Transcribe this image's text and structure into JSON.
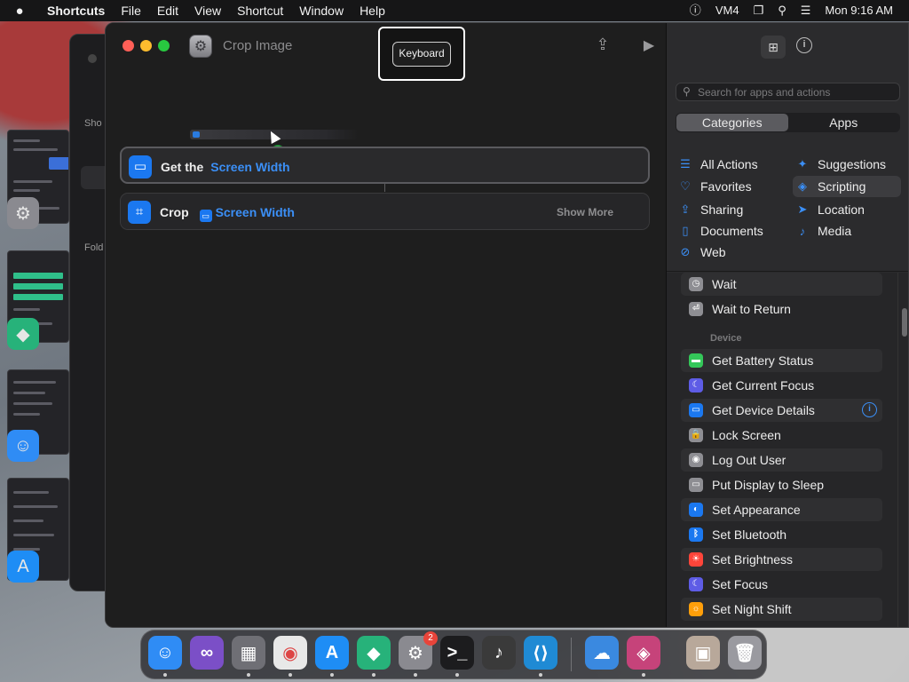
{
  "menubar": {
    "apple_icon": "apple-logo",
    "app_name": "Shortcuts",
    "menus": [
      "File",
      "Edit",
      "View",
      "Shortcut",
      "Window",
      "Help"
    ],
    "status": {
      "vm": "VM4",
      "clock": "Mon 9:16 AM"
    }
  },
  "window": {
    "title": "Crop Image",
    "tooltip": "Keyboard"
  },
  "editor": {
    "actions": [
      {
        "verb": "Get the",
        "token": "Screen Width"
      },
      {
        "verb": "Crop",
        "token": "Screen Width",
        "more": "Show More"
      }
    ]
  },
  "sidebar": {
    "search_placeholder": "Search for apps and actions",
    "segments": [
      "Categories",
      "Apps"
    ],
    "categories_left": [
      {
        "label": "All Actions",
        "icon": "list-icon"
      },
      {
        "label": "Favorites",
        "icon": "heart-icon"
      },
      {
        "label": "Sharing",
        "icon": "share-icon"
      },
      {
        "label": "Documents",
        "icon": "document-icon"
      },
      {
        "label": "Web",
        "icon": "compass-icon"
      }
    ],
    "categories_right": [
      {
        "label": "Suggestions",
        "icon": "sparkle-icon"
      },
      {
        "label": "Scripting",
        "icon": "scripting-icon"
      },
      {
        "label": "Location",
        "icon": "location-icon"
      },
      {
        "label": "Media",
        "icon": "music-note-icon"
      }
    ],
    "list": {
      "scripting_rows": [
        "Wait",
        "Wait to Return"
      ],
      "section": "Device",
      "device_rows": [
        {
          "label": "Get Battery Status",
          "color": "#34c759",
          "icon": "battery-icon"
        },
        {
          "label": "Get Current Focus",
          "color": "#5e5ce6",
          "icon": "moon-icon"
        },
        {
          "label": "Get Device Details",
          "color": "#1b78f0",
          "icon": "display-icon"
        },
        {
          "label": "Lock Screen",
          "color": "#8e8e93",
          "icon": "lock-icon"
        },
        {
          "label": "Log Out User",
          "color": "#8e8e93",
          "icon": "user-icon"
        },
        {
          "label": "Put Display to Sleep",
          "color": "#8e8e93",
          "icon": "display-sleep-icon"
        },
        {
          "label": "Set Appearance",
          "color": "#1b78f0",
          "icon": "appearance-icon"
        },
        {
          "label": "Set Bluetooth",
          "color": "#1b78f0",
          "icon": "bluetooth-icon"
        },
        {
          "label": "Set Brightness",
          "color": "#ff453a",
          "icon": "brightness-icon"
        },
        {
          "label": "Set Focus",
          "color": "#5e5ce6",
          "icon": "moon-icon"
        },
        {
          "label": "Set Night Shift",
          "color": "#ff9f0a",
          "icon": "night-shift-icon"
        }
      ]
    }
  },
  "dock": {
    "apps": [
      {
        "name": "finder-icon",
        "color": "#2f8cf5"
      },
      {
        "name": "visual-studio-icon",
        "color": "#7b4fc7"
      },
      {
        "name": "grid-tool-icon",
        "color": "#6f6f75"
      },
      {
        "name": "chrome-icon",
        "color": "#e8e8e8"
      },
      {
        "name": "app-store-icon",
        "color": "#1e8df5"
      },
      {
        "name": "remote-desktop-icon",
        "color": "#27b27a"
      },
      {
        "name": "system-settings-icon",
        "color": "#8a8a90",
        "badge": "2"
      },
      {
        "name": "terminal-icon",
        "color": "#1c1c1e"
      },
      {
        "name": "garageband-icon",
        "color": "#3a3a3a"
      },
      {
        "name": "vscode-icon",
        "color": "#1f8ad4"
      },
      {
        "name": "weather-icon",
        "color": "#3a89e0"
      },
      {
        "name": "shortcuts-icon",
        "color": "#c6437a"
      },
      {
        "name": "photo-stack-icon",
        "color": "#b8a89a"
      },
      {
        "name": "trash-icon",
        "color": "#9a9aa0"
      }
    ]
  }
}
